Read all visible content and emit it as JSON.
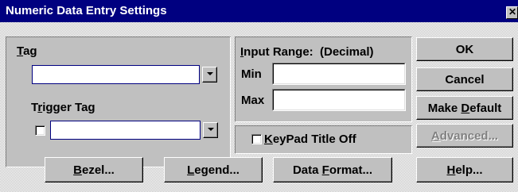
{
  "window": {
    "title": "Numeric Data Entry Settings",
    "close_glyph": "✕"
  },
  "tag_panel": {
    "tag_label": "Tag",
    "tag_value": "",
    "trigger_label": "Trigger Tag",
    "trigger_checked": false,
    "trigger_value": ""
  },
  "input_range": {
    "title": "Input Range:  (Decimal)",
    "min_label": "Min",
    "min_value": "",
    "max_label": "Max",
    "max_value": ""
  },
  "keypad": {
    "label": "KeyPad Title Off",
    "checked": false
  },
  "side_buttons": {
    "ok": "OK",
    "cancel": "Cancel",
    "make_default": "Make Default",
    "advanced": "Advanced..."
  },
  "bottom_buttons": {
    "bezel": "Bezel...",
    "legend": "Legend...",
    "data_format": "Data Format...",
    "help": "Help..."
  },
  "icons": {
    "dropdown": "chevron-down-icon",
    "close": "close-icon"
  }
}
